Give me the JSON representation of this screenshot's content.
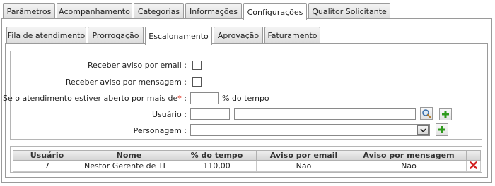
{
  "top_tabs": [
    {
      "label": "Parâmetros",
      "active": false
    },
    {
      "label": "Acompanhamento",
      "active": false
    },
    {
      "label": "Categorias",
      "active": false
    },
    {
      "label": "Informações",
      "active": false
    },
    {
      "label": "Configurações",
      "active": true
    },
    {
      "label": "Qualitor Solicitante",
      "active": false
    }
  ],
  "sub_tabs": [
    {
      "label": "Fila de atendimento",
      "active": false
    },
    {
      "label": "Prorrogação",
      "active": false
    },
    {
      "label": "Escalonamento",
      "active": true
    },
    {
      "label": "Aprovação",
      "active": false
    },
    {
      "label": "Faturamento",
      "active": false
    }
  ],
  "form": {
    "email_label": "Receber aviso por email :",
    "email_checked": false,
    "message_label": "Receber aviso por mensagem :",
    "message_checked": false,
    "open_label": "Se o atendimento estiver aberto por mais de",
    "required_mark": "*",
    "open_sep": ":",
    "open_value": "",
    "open_suffix": "% do tempo",
    "user_label": "Usuário :",
    "user_code": "",
    "user_name": "",
    "persona_label": "Personagem :",
    "persona_selected": ""
  },
  "grid": {
    "headers": [
      "Usuário",
      "Nome",
      "% do tempo",
      "Aviso por email",
      "Aviso por mensagem"
    ],
    "rows": [
      {
        "usuario": "7",
        "nome": "Nestor Gerente de TI",
        "tempo": "110,00",
        "email": "Não",
        "mensagem": "Não"
      }
    ]
  },
  "icons": {
    "search": "magnifier-icon",
    "add": "plus-icon",
    "delete": "delete-x-icon"
  },
  "colors": {
    "add_green": "#2e9a1c",
    "delete_red": "#d22222",
    "required_red": "#dd2211"
  }
}
